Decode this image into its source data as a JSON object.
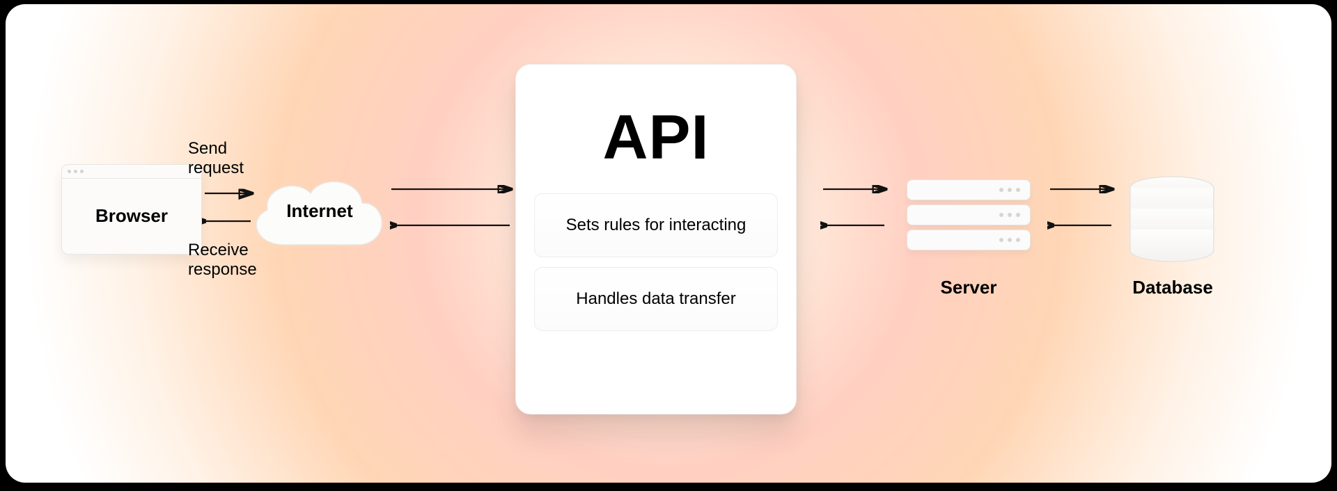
{
  "nodes": {
    "browser": "Browser",
    "internet": "Internet",
    "server": "Server",
    "database": "Database"
  },
  "api": {
    "title": "API",
    "rules": "Sets rules for interacting",
    "transfer": "Handles data transfer"
  },
  "edges": {
    "send": "Send request",
    "receive": "Receive response"
  }
}
